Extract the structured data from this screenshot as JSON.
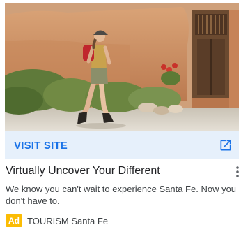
{
  "cta": {
    "label": "VISIT SITE",
    "icon": "external-link-icon",
    "color": "#1a73e8",
    "background": "#e6f0fb"
  },
  "headline": "Virtually Uncover Your Different",
  "description": "We know you can't wait to experience Santa Fe. Now you don't have to.",
  "ad": {
    "badge": "Ad",
    "badge_color": "#fbbc04",
    "advertiser": "TOURISM Santa Fe"
  },
  "menu": {
    "icon": "more-vert-icon"
  }
}
